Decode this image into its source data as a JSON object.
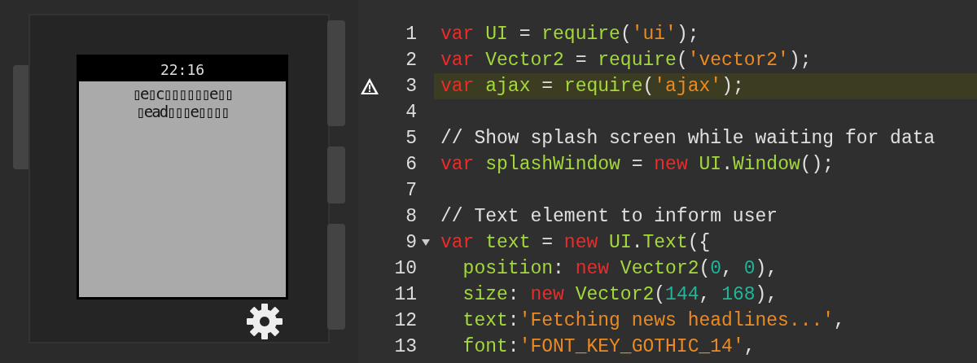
{
  "watch": {
    "time": "22:16",
    "message_lines": [
      "▯e▯c▯▯▯▯▯▯e▯▯",
      "▯ead▯▯▯e▯▯▯▯"
    ]
  },
  "editor": {
    "lines": [
      {
        "number": "1",
        "highlighted": false,
        "warning": false,
        "foldable": false,
        "tokens": [
          {
            "kind": "keyword",
            "text": "var"
          },
          {
            "kind": "ident",
            "text": " UI"
          },
          {
            "kind": "plain",
            "text": " = "
          },
          {
            "kind": "ident",
            "text": "require"
          },
          {
            "kind": "plain",
            "text": "("
          },
          {
            "kind": "string",
            "text": "'ui'"
          },
          {
            "kind": "plain",
            "text": ");"
          }
        ]
      },
      {
        "number": "2",
        "highlighted": false,
        "warning": false,
        "foldable": false,
        "tokens": [
          {
            "kind": "keyword",
            "text": "var"
          },
          {
            "kind": "ident",
            "text": " Vector2"
          },
          {
            "kind": "plain",
            "text": " = "
          },
          {
            "kind": "ident",
            "text": "require"
          },
          {
            "kind": "plain",
            "text": "("
          },
          {
            "kind": "string",
            "text": "'vector2'"
          },
          {
            "kind": "plain",
            "text": ");"
          }
        ]
      },
      {
        "number": "3",
        "highlighted": true,
        "warning": true,
        "foldable": false,
        "tokens": [
          {
            "kind": "keyword",
            "text": "var"
          },
          {
            "kind": "ident",
            "text": " ajax"
          },
          {
            "kind": "plain",
            "text": " = "
          },
          {
            "kind": "ident",
            "text": "require"
          },
          {
            "kind": "plain",
            "text": "("
          },
          {
            "kind": "string",
            "text": "'ajax'"
          },
          {
            "kind": "plain",
            "text": ");"
          }
        ]
      },
      {
        "number": "4",
        "highlighted": false,
        "warning": false,
        "foldable": false
      },
      {
        "number": "5",
        "highlighted": false,
        "warning": false,
        "foldable": false,
        "tokens": [
          {
            "kind": "comment",
            "text": "// Show splash screen while waiting for data"
          }
        ]
      },
      {
        "number": "6",
        "highlighted": false,
        "warning": false,
        "foldable": false,
        "tokens": [
          {
            "kind": "keyword",
            "text": "var"
          },
          {
            "kind": "ident",
            "text": " splashWindow"
          },
          {
            "kind": "plain",
            "text": " = "
          },
          {
            "kind": "keyword",
            "text": "new"
          },
          {
            "kind": "ident",
            "text": " UI"
          },
          {
            "kind": "plain",
            "text": "."
          },
          {
            "kind": "ident",
            "text": "Window"
          },
          {
            "kind": "plain",
            "text": "();"
          }
        ]
      },
      {
        "number": "7",
        "highlighted": false,
        "warning": false,
        "foldable": false
      },
      {
        "number": "8",
        "highlighted": false,
        "warning": false,
        "foldable": false,
        "tokens": [
          {
            "kind": "comment",
            "text": "// Text element to inform user"
          }
        ]
      },
      {
        "number": "9",
        "highlighted": false,
        "warning": false,
        "foldable": true,
        "tokens": [
          {
            "kind": "keyword",
            "text": "var"
          },
          {
            "kind": "ident",
            "text": " text"
          },
          {
            "kind": "plain",
            "text": " = "
          },
          {
            "kind": "keyword",
            "text": "new"
          },
          {
            "kind": "ident",
            "text": " UI"
          },
          {
            "kind": "plain",
            "text": "."
          },
          {
            "kind": "ident",
            "text": "Text"
          },
          {
            "kind": "plain",
            "text": "({"
          }
        ]
      },
      {
        "number": "10",
        "highlighted": false,
        "warning": false,
        "foldable": false,
        "tokens": [
          {
            "kind": "ident",
            "text": "  position"
          },
          {
            "kind": "plain",
            "text": ": "
          },
          {
            "kind": "keyword",
            "text": "new"
          },
          {
            "kind": "ident",
            "text": " Vector2"
          },
          {
            "kind": "plain",
            "text": "("
          },
          {
            "kind": "number",
            "text": "0"
          },
          {
            "kind": "plain",
            "text": ", "
          },
          {
            "kind": "number",
            "text": "0"
          },
          {
            "kind": "plain",
            "text": "),"
          }
        ]
      },
      {
        "number": "11",
        "highlighted": false,
        "warning": false,
        "foldable": false,
        "tokens": [
          {
            "kind": "ident",
            "text": "  size"
          },
          {
            "kind": "plain",
            "text": ": "
          },
          {
            "kind": "keyword",
            "text": "new"
          },
          {
            "kind": "ident",
            "text": " Vector2"
          },
          {
            "kind": "plain",
            "text": "("
          },
          {
            "kind": "number",
            "text": "144"
          },
          {
            "kind": "plain",
            "text": ", "
          },
          {
            "kind": "number",
            "text": "168"
          },
          {
            "kind": "plain",
            "text": "),"
          }
        ]
      },
      {
        "number": "12",
        "highlighted": false,
        "warning": false,
        "foldable": false,
        "tokens": [
          {
            "kind": "ident",
            "text": "  text"
          },
          {
            "kind": "plain",
            "text": ":"
          },
          {
            "kind": "string",
            "text": "'Fetching news headlines...'"
          },
          {
            "kind": "plain",
            "text": ","
          }
        ]
      },
      {
        "number": "13",
        "highlighted": false,
        "warning": false,
        "foldable": false,
        "tokens": [
          {
            "kind": "ident",
            "text": "  font"
          },
          {
            "kind": "plain",
            "text": ":"
          },
          {
            "kind": "string",
            "text": "'FONT_KEY_GOTHIC_14'"
          },
          {
            "kind": "plain",
            "text": ","
          }
        ]
      }
    ]
  }
}
